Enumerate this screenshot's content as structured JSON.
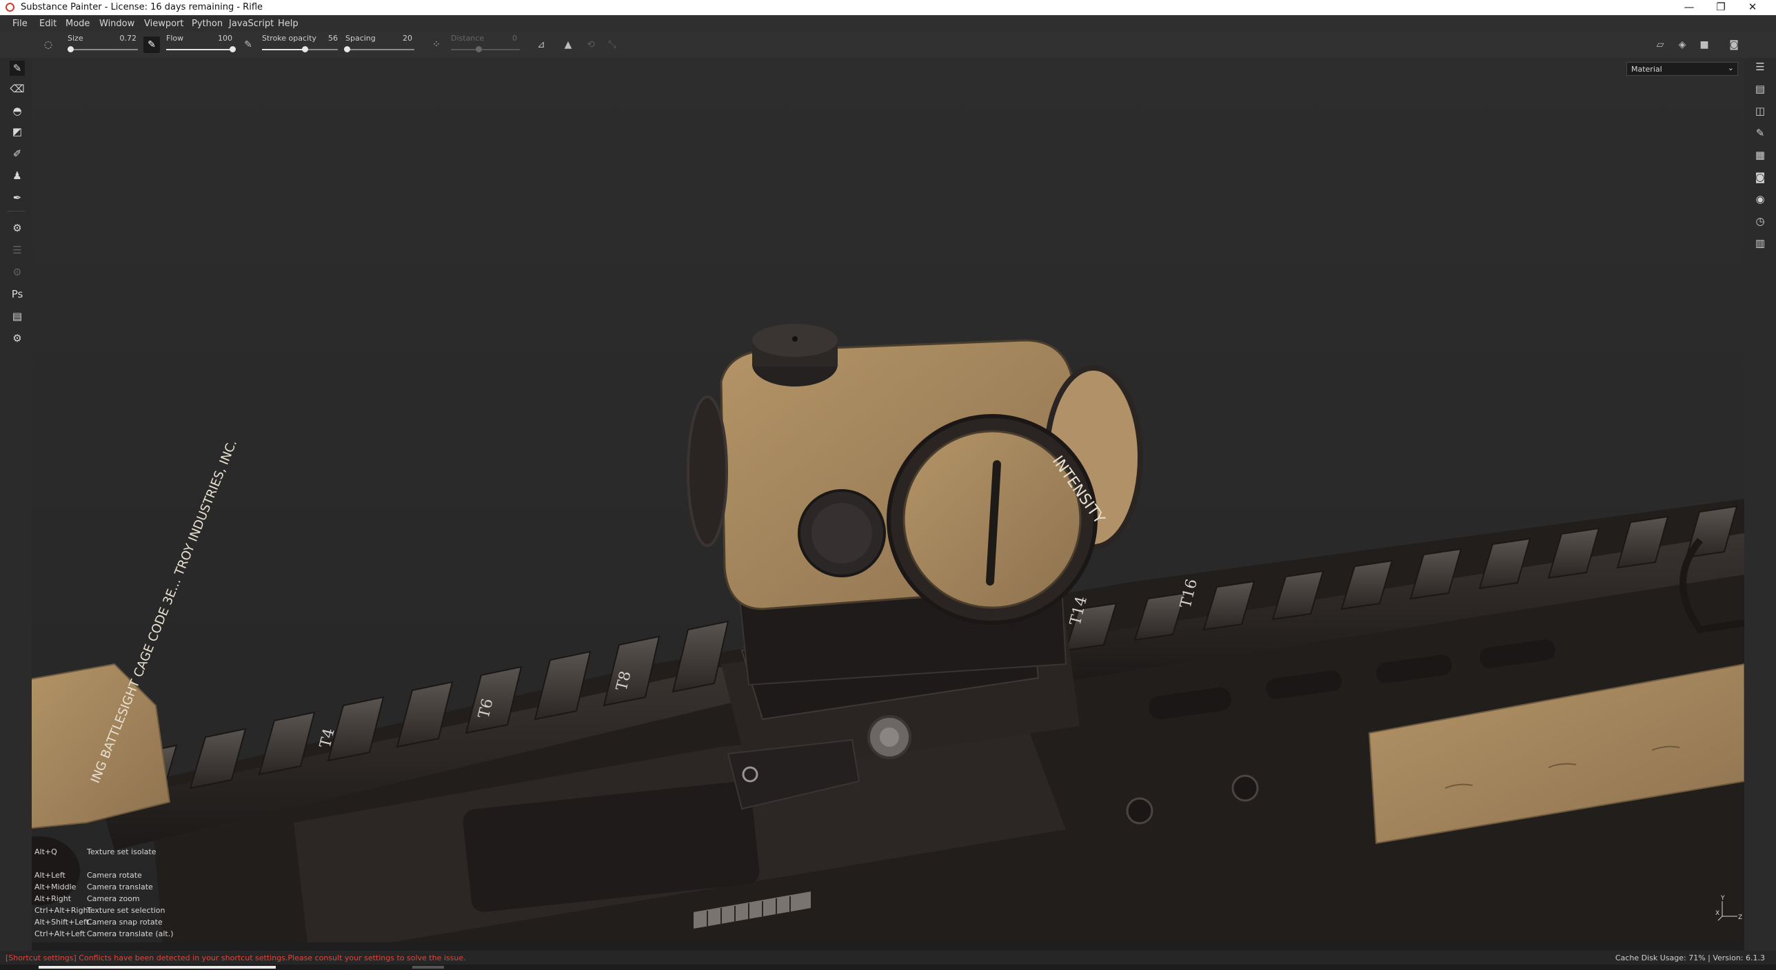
{
  "window": {
    "title": "Substance Painter - License: 16 days remaining - Rifle",
    "minimize": "—",
    "restore": "❐",
    "close": "✕"
  },
  "menu": [
    "File",
    "Edit",
    "Mode",
    "Window",
    "Viewport",
    "Python",
    "JavaScript",
    "Help"
  ],
  "tool_options": {
    "size_label": "Size",
    "size_value": "0.72",
    "size_level": 0.04,
    "flow_label": "Flow",
    "flow_value": "100",
    "flow_level": 1.0,
    "stroke_opacity_label": "Stroke opacity",
    "stroke_opacity_value": "56",
    "stroke_opacity_level": 0.56,
    "spacing_label": "Spacing",
    "spacing_value": "20",
    "spacing_level": 0.02,
    "distance_label": "Distance",
    "distance_value": "0",
    "distance_level": 0.4
  },
  "viewport": {
    "mode_select": "Material",
    "engraving_text": "INTENSITY",
    "flashlight_text": "ING BATTLESIGHT CAGE CODE 3E... TROY INDUSTRIES, INC.",
    "rail_marks": [
      "T4",
      "T6",
      "T8",
      "T14",
      "T16"
    ]
  },
  "shortcuts": [
    {
      "keys": "Alt+Q",
      "action": "Texture set isolate"
    },
    {
      "keys": "Alt+Left",
      "action": "Camera rotate"
    },
    {
      "keys": "Alt+Middle",
      "action": "Camera translate"
    },
    {
      "keys": "Alt+Right",
      "action": "Camera zoom"
    },
    {
      "keys": "Ctrl+Alt+Right",
      "action": "Texture set selection"
    },
    {
      "keys": "Alt+Shift+Left",
      "action": "Camera snap rotate"
    },
    {
      "keys": "Ctrl+Alt+Left",
      "action": "Camera translate (alt.)"
    }
  ],
  "axis": {
    "y": "Y",
    "x": "X",
    "z": "Z"
  },
  "status": {
    "warning": "[Shortcut settings] Conflicts have been detected in your shortcut settings.Please consult your settings to solve the issue.",
    "cache": "Cache Disk Usage:   71% | Version: 6.1.3"
  },
  "colors": {
    "tan": "#a8895f",
    "metal_dark": "#2a2522",
    "viewport_bg": "#2a2a2a",
    "warning_red": "#e0463a"
  }
}
